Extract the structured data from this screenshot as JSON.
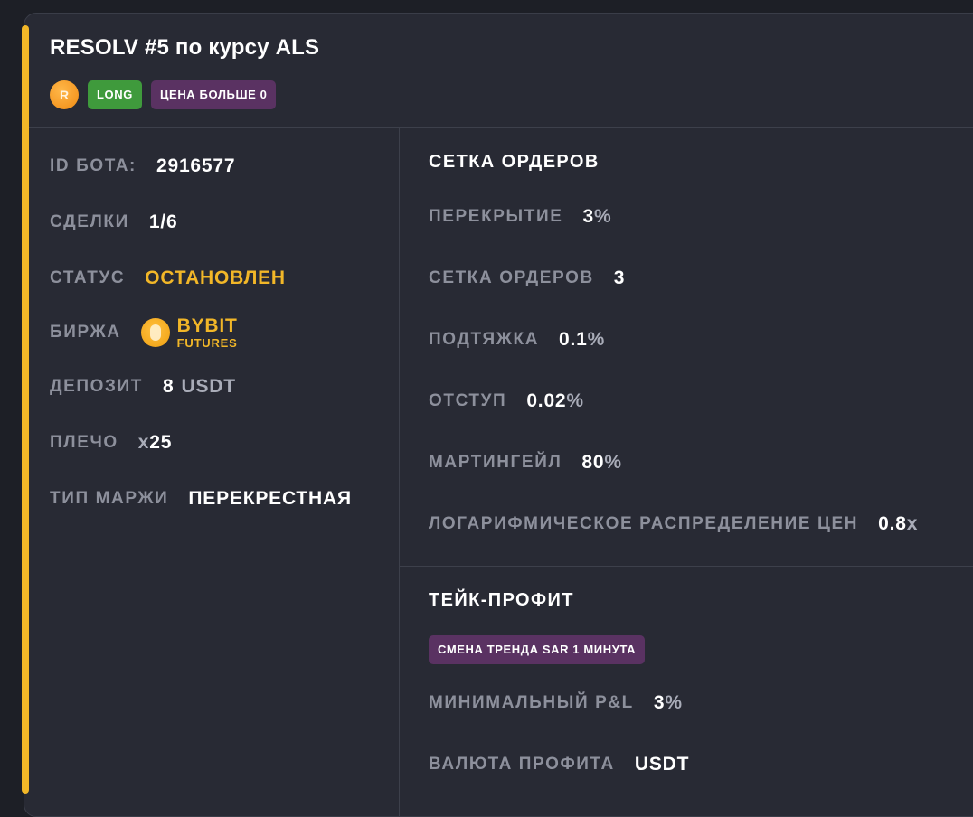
{
  "bot": {
    "title": "RESOLV #5 по курсу ALS",
    "coin_letter": "R",
    "direction": "LONG",
    "condition": "ЦЕНА БОЛЬШЕ 0"
  },
  "info": {
    "id_label": "ID БОТА:",
    "id_value": "2916577",
    "deals_label": "СДЕЛКИ",
    "deals_value": "1/6",
    "status_label": "СТАТУС",
    "status_value": "ОСТАНОВЛЕН",
    "exchange_label": "БИРЖА",
    "exchange_name": "BYBIT",
    "exchange_type": "FUTURES",
    "deposit_label": "ДЕПОЗИТ",
    "deposit_value": "8",
    "deposit_unit": "USDT",
    "leverage_label": "ПЛЕЧО",
    "leverage_prefix": "x",
    "leverage_value": "25",
    "margin_label": "ТИП МАРЖИ",
    "margin_value": "ПЕРЕКРЕСТНАЯ"
  },
  "grid": {
    "title": "СЕТКА ОРДЕРОВ",
    "overlap_label": "ПЕРЕКРЫТИЕ",
    "overlap_value": "3",
    "overlap_unit": "%",
    "orders_label": "СЕТКА ОРДЕРОВ",
    "orders_value": "3",
    "pullup_label": "ПОДТЯЖКА",
    "pullup_value": "0.1",
    "pullup_unit": "%",
    "indent_label": "ОТСТУП",
    "indent_value": "0.02",
    "indent_unit": "%",
    "martingale_label": "МАРТИНГЕЙЛ",
    "martingale_value": "80",
    "martingale_unit": "%",
    "log_label": "ЛОГАРИФМИЧЕСКОЕ РАСПРЕДЕЛЕНИЕ ЦЕН",
    "log_value": "0.8",
    "log_unit": "x"
  },
  "take_profit": {
    "title": "ТЕЙК-ПРОФИТ",
    "mode": "СМЕНА ТРЕНДА SAR 1 МИНУТА",
    "min_pnl_label": "МИНИМАЛЬНЫЙ P&L",
    "min_pnl_value": "3",
    "min_pnl_unit": "%",
    "currency_label": "ВАЛЮТА ПРОФИТА",
    "currency_value": "USDT"
  },
  "colors": {
    "accent": "#f2b728",
    "long": "#3f9a3c",
    "tag": "#5a3262",
    "card_bg": "#282a34"
  },
  "icons": {
    "coin": "resolv-coin-icon",
    "exchange": "bybit-logo-icon"
  }
}
